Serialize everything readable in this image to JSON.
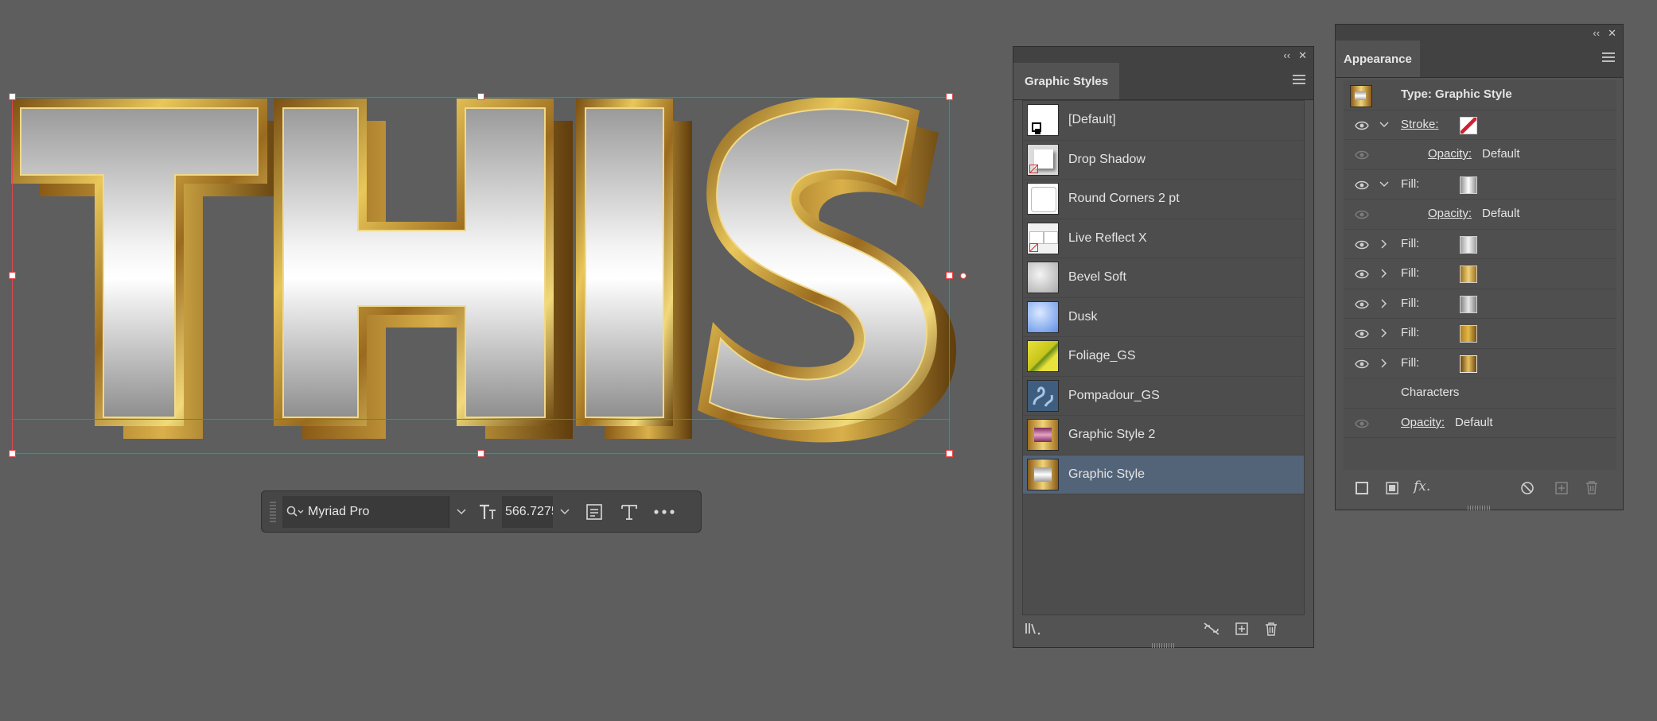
{
  "artwork": {
    "text": "THIS"
  },
  "context_toolbar": {
    "font_name": "Myriad Pro",
    "font_size": "566.7275"
  },
  "graphic_styles": {
    "title": "Graphic Styles",
    "items": [
      {
        "label": "[Default]"
      },
      {
        "label": "Drop Shadow"
      },
      {
        "label": "Round Corners 2 pt"
      },
      {
        "label": "Live Reflect X"
      },
      {
        "label": "Bevel Soft"
      },
      {
        "label": "Dusk"
      },
      {
        "label": "Foliage_GS"
      },
      {
        "label": "Pompadour_GS"
      },
      {
        "label": "Graphic Style 2"
      },
      {
        "label": "Graphic Style"
      }
    ],
    "selected": "Graphic Style"
  },
  "appearance": {
    "title": "Appearance",
    "type_label": "Type: Graphic Style",
    "stroke_label": "Stroke:",
    "opacity_label": "Opacity:",
    "opacity_value": "Default",
    "fill_label": "Fill:",
    "characters_label": "Characters"
  },
  "colors": {
    "canvas": "#5e5e5e",
    "panel": "#535353",
    "selection": "#536479",
    "bounding_box": "#e0474a",
    "gold": "#c9a23a"
  }
}
